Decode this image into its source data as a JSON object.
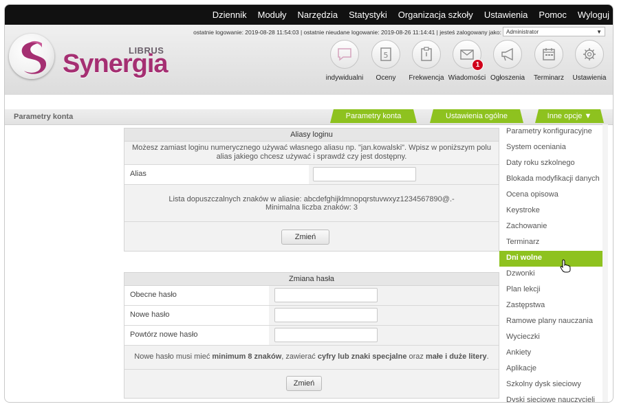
{
  "topnav": {
    "items": [
      "Dziennik",
      "Moduły",
      "Narzędzia",
      "Statystyki",
      "Organizacja szkoły",
      "Ustawienia",
      "Pomoc",
      "Wyloguj"
    ]
  },
  "header": {
    "login_info": "ostatnie logowanie: 2019-08-28 11:54:03  |  ostatnie nieudane logowanie: 2019-08-26 11:14:41  |  jesteś zalogowany jako:",
    "user_select_value": "Administrator",
    "logo_small": "LIBRUS",
    "logo_big": "Synergia",
    "tiles": [
      {
        "label": "indywidualni",
        "icon": "speech-bubble-icon"
      },
      {
        "label": "Oceny",
        "icon": "grade-document-icon"
      },
      {
        "label": "Frekwencja",
        "icon": "clipboard-icon"
      },
      {
        "label": "Wiadomości",
        "icon": "envelope-icon",
        "badge": "1"
      },
      {
        "label": "Ogłoszenia",
        "icon": "megaphone-icon"
      },
      {
        "label": "Terminarz",
        "icon": "calendar-icon"
      },
      {
        "label": "Ustawienia",
        "icon": "gear-icon"
      }
    ]
  },
  "section": {
    "title": "Parametry konta",
    "tabs": [
      "Parametry konta",
      "Ustawienia ogólne",
      "Inne opcje ▼"
    ]
  },
  "alias_box": {
    "title": "Aliasy loginu",
    "description": "Możesz zamiast loginu numerycznego używać własnego aliasu np. \"jan.kowalski\". Wpisz w poniższym polu alias jakiego chcesz używać i sprawdź czy jest dostępny.",
    "alias_label": "Alias",
    "alias_value": "",
    "allowed_chars": "Lista dopuszczalnych znaków w aliasie: abcdefghijklmnopqrstuvwxyz1234567890@.-",
    "min_chars": "Minimalna liczba znaków: 3",
    "button": "Zmień"
  },
  "password_box": {
    "title": "Zmiana hasła",
    "fields": [
      {
        "label": "Obecne hasło",
        "value": ""
      },
      {
        "label": "Nowe hasło",
        "value": ""
      },
      {
        "label": "Powtórz nowe hasło",
        "value": ""
      }
    ],
    "rule_1": "Nowe hasło musi mieć ",
    "rule_2": "minimum 8 znaków",
    "rule_3": ", zawierać ",
    "rule_4": "cyfry lub znaki specjalne",
    "rule_5": " oraz ",
    "rule_6": "małe i duże litery",
    "rule_7": ".",
    "button": "Zmień"
  },
  "right_menu": {
    "items": [
      "Parametry konfiguracyjne",
      "System oceniania",
      "Daty roku szkolnego",
      "Blokada modyfikacji danych",
      "Ocena opisowa",
      "Keystroke",
      "Zachowanie",
      "Terminarz",
      "Dni wolne",
      "Dzwonki",
      "Plan lekcji",
      "Zastępstwa",
      "Ramowe plany nauczania",
      "Wycieczki",
      "Ankiety",
      "Aplikacje",
      "Szkolny dysk sieciowy",
      "Dyski sieciowe nauczycieli"
    ],
    "active": "Dni wolne"
  },
  "colors": {
    "accent_green": "#8ec21f",
    "brand_magenta": "#a52f72",
    "badge_red": "#d0011b"
  }
}
